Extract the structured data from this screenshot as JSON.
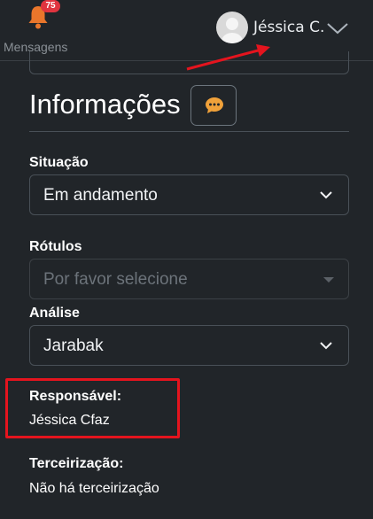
{
  "header": {
    "messages_label": "Mensagens",
    "messages_badge": "75",
    "user_name": "Jéssica C."
  },
  "section": {
    "title": "Informações"
  },
  "fields": {
    "situacao": {
      "label": "Situação",
      "value": "Em andamento"
    },
    "rotulos": {
      "label": "Rótulos",
      "placeholder": "Por favor selecione"
    },
    "analise": {
      "label": "Análise",
      "value": "Jarabak"
    },
    "responsavel": {
      "label": "Responsável:",
      "value": "Jéssica Cfaz"
    },
    "terceirizacao": {
      "label": "Terceirização:",
      "value": "Não há terceirização"
    }
  },
  "colors": {
    "background": "#212529",
    "badge": "#e0343f",
    "bell": "#e9762b",
    "chat_icon": "#f0a13a",
    "annotation": "#e4141e"
  },
  "icons": {
    "bell": "bell-icon",
    "avatar": "user-avatar",
    "user_menu": "chevron-down-icon",
    "chat": "chat-bubble-icon",
    "select": "chevron-down-icon"
  }
}
